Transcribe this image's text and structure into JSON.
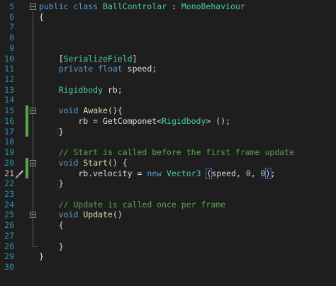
{
  "editor": {
    "lines": [
      {
        "num": "5",
        "parts": [
          {
            "t": "public",
            "c": "kw"
          },
          {
            "t": " "
          },
          {
            "t": "class",
            "c": "kw"
          },
          {
            "t": " "
          },
          {
            "t": "BallControlar",
            "c": "ty"
          },
          {
            "t": " : "
          },
          {
            "t": "MonoBehaviour",
            "c": "ty"
          }
        ]
      },
      {
        "num": "6",
        "parts": [
          {
            "t": "{"
          }
        ]
      },
      {
        "num": "7",
        "parts": []
      },
      {
        "num": "8",
        "parts": []
      },
      {
        "num": "9",
        "parts": []
      },
      {
        "num": "10",
        "parts": [
          {
            "t": "    ["
          },
          {
            "t": "SerializeField",
            "c": "ty"
          },
          {
            "t": "]"
          }
        ]
      },
      {
        "num": "11",
        "parts": [
          {
            "t": "    "
          },
          {
            "t": "private",
            "c": "kw"
          },
          {
            "t": " "
          },
          {
            "t": "float",
            "c": "kw"
          },
          {
            "t": " speed;"
          }
        ]
      },
      {
        "num": "12",
        "parts": []
      },
      {
        "num": "13",
        "parts": [
          {
            "t": "    "
          },
          {
            "t": "Rigidbody",
            "c": "ty"
          },
          {
            "t": " rb;"
          }
        ]
      },
      {
        "num": "14",
        "parts": []
      },
      {
        "num": "15",
        "parts": [
          {
            "t": "    "
          },
          {
            "t": "void",
            "c": "kw"
          },
          {
            "t": " "
          },
          {
            "t": "Awake",
            "c": "fn"
          },
          {
            "t": "(){"
          }
        ]
      },
      {
        "num": "16",
        "parts": [
          {
            "t": "        rb = GetComponet<"
          },
          {
            "t": "Rigidbody",
            "c": "ty"
          },
          {
            "t": "> ();"
          }
        ]
      },
      {
        "num": "17",
        "parts": [
          {
            "t": "    }"
          }
        ]
      },
      {
        "num": "18",
        "parts": []
      },
      {
        "num": "19",
        "parts": [
          {
            "t": "    "
          },
          {
            "t": "// Start is called before the first frame update",
            "c": "cm"
          }
        ]
      },
      {
        "num": "20",
        "parts": [
          {
            "t": "    "
          },
          {
            "t": "void",
            "c": "kw"
          },
          {
            "t": " "
          },
          {
            "t": "Start",
            "c": "fn"
          },
          {
            "t": "() {"
          }
        ]
      },
      {
        "num": "21",
        "parts": [
          {
            "t": "        rb.velocity = "
          },
          {
            "t": "new",
            "c": "kw"
          },
          {
            "t": " "
          },
          {
            "t": "Vector3",
            "c": "ty"
          },
          {
            "t": " "
          },
          {
            "t": "(",
            "c": "hl"
          },
          {
            "t": "speed, "
          },
          {
            "t": "0",
            "c": "nm"
          },
          {
            "t": ", "
          },
          {
            "t": "0",
            "c": "nm"
          },
          {
            "t": ")",
            "c": "hl"
          },
          {
            "t": ";"
          }
        ]
      },
      {
        "num": "22",
        "parts": [
          {
            "t": "    }"
          }
        ]
      },
      {
        "num": "23",
        "parts": []
      },
      {
        "num": "24",
        "parts": [
          {
            "t": "    "
          },
          {
            "t": "// Update is called once per frame",
            "c": "cm"
          }
        ]
      },
      {
        "num": "25",
        "parts": [
          {
            "t": "    "
          },
          {
            "t": "void",
            "c": "kw"
          },
          {
            "t": " "
          },
          {
            "t": "Update",
            "c": "fn"
          },
          {
            "t": "()"
          }
        ]
      },
      {
        "num": "26",
        "parts": [
          {
            "t": "    {"
          }
        ]
      },
      {
        "num": "27",
        "parts": []
      },
      {
        "num": "28",
        "parts": [
          {
            "t": "    }"
          }
        ]
      },
      {
        "num": "29",
        "parts": [
          {
            "t": "}"
          }
        ]
      },
      {
        "num": "30",
        "parts": []
      }
    ],
    "active_line": "21",
    "changed_lines": [
      "15",
      "16",
      "17",
      "20",
      "21"
    ],
    "fold_lines": [
      "5",
      "15",
      "20",
      "25"
    ],
    "icons": {
      "gutter": "paintbrush-icon"
    },
    "colors": {
      "background": "#1e1e1e",
      "line_number": "#2b91af",
      "keyword": "#569cd6",
      "type": "#4ec9b0",
      "method": "#dcdcaa",
      "comment": "#57a64a",
      "number": "#b5cea8",
      "text": "#dcdcdc",
      "change_marker": "#57a64a"
    }
  }
}
